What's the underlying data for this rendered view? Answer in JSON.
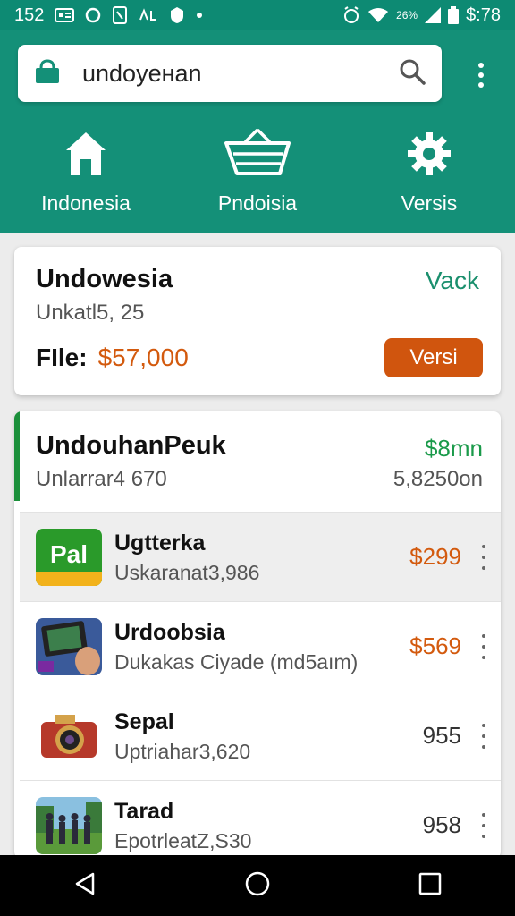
{
  "status_bar": {
    "time": "152",
    "battery_text": "26%",
    "clock_right": "$:78"
  },
  "search": {
    "query": "undoyeнan"
  },
  "nav": [
    {
      "label": "Indonesia",
      "icon": "home-icon"
    },
    {
      "label": "Pndoisia",
      "icon": "basket-icon"
    },
    {
      "label": "Versis",
      "icon": "gear-icon"
    }
  ],
  "card1": {
    "title": "Undowesia",
    "link": "Vack",
    "subtitle": "Unkatl5, 25",
    "price_label": "FIle:",
    "price": "$57,000",
    "button": "Versi"
  },
  "card2": {
    "title": "UndouhanPeuk",
    "amount": "$8mn",
    "subtitle": "Unlarrar4 670",
    "subtitle_right": "5,8250on",
    "items": [
      {
        "name": "Ugtterka",
        "meta": "Uskaranat3,986",
        "price": "$299",
        "thumb_text": "Pal",
        "thumb_icon": "pal-app-icon",
        "price_color": "orange"
      },
      {
        "name": "Urdoobsia",
        "meta": "Dukakas Ciyade (md5aım)",
        "price": "$569",
        "thumb_icon": "device-photo-icon",
        "price_color": "orange"
      },
      {
        "name": "Sepal",
        "meta": "Uptriahar3,620",
        "price": "955",
        "thumb_icon": "camera-icon",
        "price_color": "gray"
      },
      {
        "name": "Tarad",
        "meta": "EpotrleatZ,S30",
        "price": "958",
        "thumb_icon": "group-photo-icon",
        "price_color": "gray"
      }
    ]
  },
  "colors": {
    "header": "#149078",
    "accent_orange": "#d0550e",
    "accent_green": "#1a8f6d"
  }
}
